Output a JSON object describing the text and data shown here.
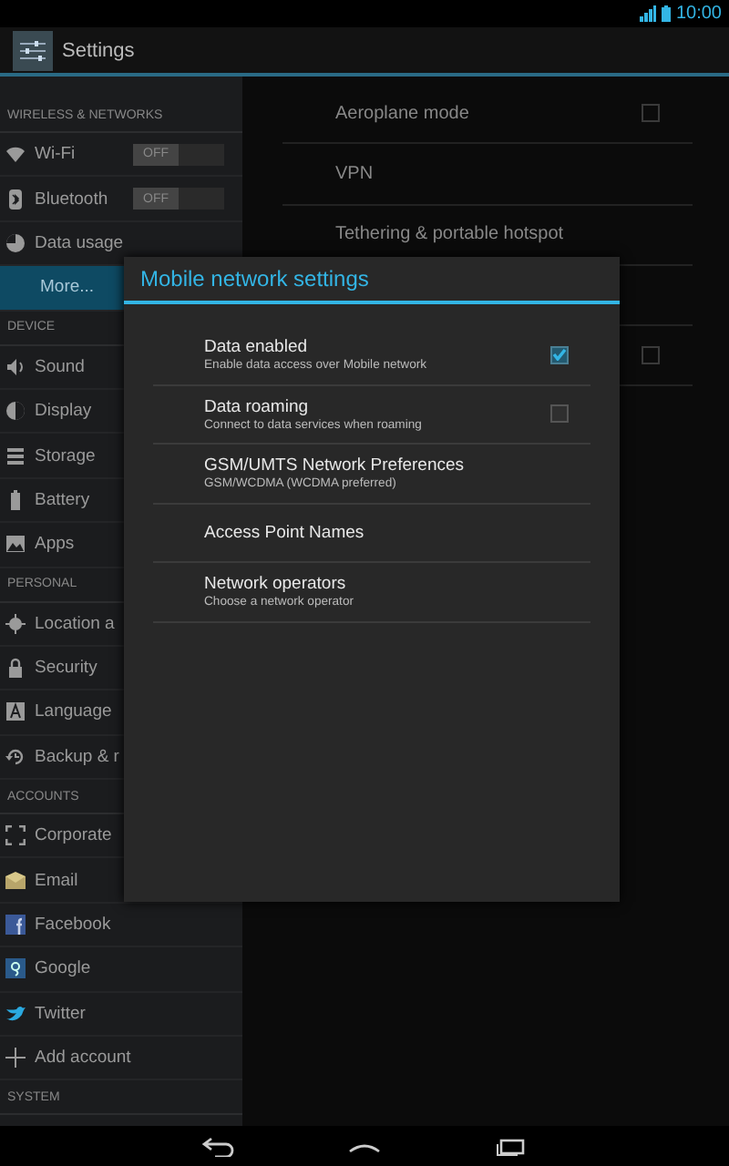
{
  "status_bar": {
    "time": "10:00"
  },
  "action_bar": {
    "title": "Settings"
  },
  "sidebar": {
    "sections": [
      {
        "header": "WIRELESS & NETWORKS",
        "items": [
          {
            "label": "Wi-Fi",
            "selected": false,
            "toggle": {
              "label": "OFF",
              "on": false
            }
          },
          {
            "label": "Bluetooth",
            "selected": false,
            "toggle": {
              "label": "OFF",
              "on": false
            }
          },
          {
            "label": "Data usage",
            "selected": false
          },
          {
            "label": "More...",
            "selected": true
          }
        ]
      },
      {
        "header": "DEVICE",
        "items": [
          {
            "label": "Sound",
            "selected": false
          },
          {
            "label": "Display",
            "selected": false
          },
          {
            "label": "Storage",
            "selected": false
          },
          {
            "label": "Battery",
            "selected": false
          },
          {
            "label": "Apps",
            "selected": false
          }
        ]
      },
      {
        "header": "PERSONAL",
        "items": [
          {
            "label": "Location a",
            "selected": false
          },
          {
            "label": "Security",
            "selected": false
          },
          {
            "label": "Language",
            "selected": false
          },
          {
            "label": "Backup & r",
            "selected": false
          }
        ]
      },
      {
        "header": "ACCOUNTS",
        "items": [
          {
            "label": "Corporate",
            "selected": false
          },
          {
            "label": "Email",
            "selected": false
          },
          {
            "label": "Facebook",
            "selected": false
          },
          {
            "label": "Google",
            "selected": false
          },
          {
            "label": "Twitter",
            "selected": false
          },
          {
            "label": "Add account",
            "selected": false
          }
        ]
      },
      {
        "header": "SYSTEM"
      }
    ]
  },
  "detail": {
    "rows": [
      {
        "kind": "checkbox",
        "label": "Aeroplane mode",
        "checked": false
      },
      {
        "kind": "plain",
        "label": "VPN"
      },
      {
        "kind": "plain",
        "label": "Tethering & portable hotspot"
      },
      {
        "kind": "blank"
      },
      {
        "kind": "checkbox",
        "checked": false
      }
    ]
  },
  "dialog": {
    "title": "Mobile network settings",
    "rows": [
      {
        "kind": "checkbox",
        "title": "Data enabled",
        "summary": "Enable data access over Mobile network",
        "checked": true
      },
      {
        "kind": "checkbox",
        "title": "Data roaming",
        "summary": "Connect to data services when roaming",
        "checked": false
      },
      {
        "kind": "plain",
        "title": "GSM/UMTS Network Preferences",
        "summary": "GSM/WCDMA (WCDMA preferred)"
      },
      {
        "kind": "plain",
        "title": "Access Point Names"
      },
      {
        "kind": "plain",
        "title": "Network operators",
        "summary": "Choose a network operator"
      }
    ]
  }
}
